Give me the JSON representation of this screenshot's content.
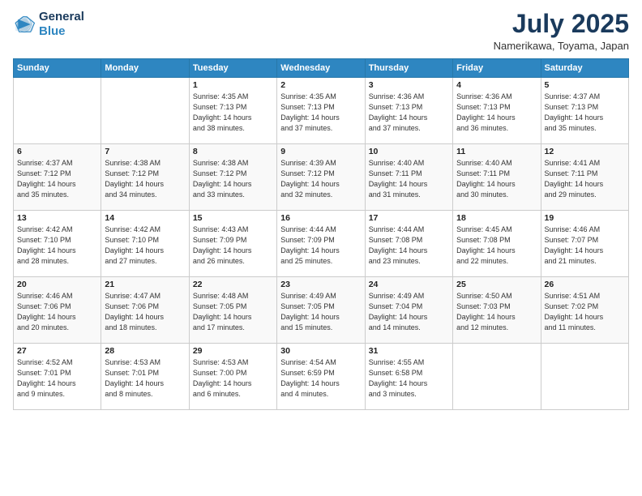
{
  "logo": {
    "line1": "General",
    "line2": "Blue"
  },
  "title": "July 2025",
  "subtitle": "Namerikawa, Toyama, Japan",
  "headers": [
    "Sunday",
    "Monday",
    "Tuesday",
    "Wednesday",
    "Thursday",
    "Friday",
    "Saturday"
  ],
  "weeks": [
    [
      {
        "day": "",
        "info": ""
      },
      {
        "day": "",
        "info": ""
      },
      {
        "day": "1",
        "info": "Sunrise: 4:35 AM\nSunset: 7:13 PM\nDaylight: 14 hours\nand 38 minutes."
      },
      {
        "day": "2",
        "info": "Sunrise: 4:35 AM\nSunset: 7:13 PM\nDaylight: 14 hours\nand 37 minutes."
      },
      {
        "day": "3",
        "info": "Sunrise: 4:36 AM\nSunset: 7:13 PM\nDaylight: 14 hours\nand 37 minutes."
      },
      {
        "day": "4",
        "info": "Sunrise: 4:36 AM\nSunset: 7:13 PM\nDaylight: 14 hours\nand 36 minutes."
      },
      {
        "day": "5",
        "info": "Sunrise: 4:37 AM\nSunset: 7:13 PM\nDaylight: 14 hours\nand 35 minutes."
      }
    ],
    [
      {
        "day": "6",
        "info": "Sunrise: 4:37 AM\nSunset: 7:12 PM\nDaylight: 14 hours\nand 35 minutes."
      },
      {
        "day": "7",
        "info": "Sunrise: 4:38 AM\nSunset: 7:12 PM\nDaylight: 14 hours\nand 34 minutes."
      },
      {
        "day": "8",
        "info": "Sunrise: 4:38 AM\nSunset: 7:12 PM\nDaylight: 14 hours\nand 33 minutes."
      },
      {
        "day": "9",
        "info": "Sunrise: 4:39 AM\nSunset: 7:12 PM\nDaylight: 14 hours\nand 32 minutes."
      },
      {
        "day": "10",
        "info": "Sunrise: 4:40 AM\nSunset: 7:11 PM\nDaylight: 14 hours\nand 31 minutes."
      },
      {
        "day": "11",
        "info": "Sunrise: 4:40 AM\nSunset: 7:11 PM\nDaylight: 14 hours\nand 30 minutes."
      },
      {
        "day": "12",
        "info": "Sunrise: 4:41 AM\nSunset: 7:11 PM\nDaylight: 14 hours\nand 29 minutes."
      }
    ],
    [
      {
        "day": "13",
        "info": "Sunrise: 4:42 AM\nSunset: 7:10 PM\nDaylight: 14 hours\nand 28 minutes."
      },
      {
        "day": "14",
        "info": "Sunrise: 4:42 AM\nSunset: 7:10 PM\nDaylight: 14 hours\nand 27 minutes."
      },
      {
        "day": "15",
        "info": "Sunrise: 4:43 AM\nSunset: 7:09 PM\nDaylight: 14 hours\nand 26 minutes."
      },
      {
        "day": "16",
        "info": "Sunrise: 4:44 AM\nSunset: 7:09 PM\nDaylight: 14 hours\nand 25 minutes."
      },
      {
        "day": "17",
        "info": "Sunrise: 4:44 AM\nSunset: 7:08 PM\nDaylight: 14 hours\nand 23 minutes."
      },
      {
        "day": "18",
        "info": "Sunrise: 4:45 AM\nSunset: 7:08 PM\nDaylight: 14 hours\nand 22 minutes."
      },
      {
        "day": "19",
        "info": "Sunrise: 4:46 AM\nSunset: 7:07 PM\nDaylight: 14 hours\nand 21 minutes."
      }
    ],
    [
      {
        "day": "20",
        "info": "Sunrise: 4:46 AM\nSunset: 7:06 PM\nDaylight: 14 hours\nand 20 minutes."
      },
      {
        "day": "21",
        "info": "Sunrise: 4:47 AM\nSunset: 7:06 PM\nDaylight: 14 hours\nand 18 minutes."
      },
      {
        "day": "22",
        "info": "Sunrise: 4:48 AM\nSunset: 7:05 PM\nDaylight: 14 hours\nand 17 minutes."
      },
      {
        "day": "23",
        "info": "Sunrise: 4:49 AM\nSunset: 7:05 PM\nDaylight: 14 hours\nand 15 minutes."
      },
      {
        "day": "24",
        "info": "Sunrise: 4:49 AM\nSunset: 7:04 PM\nDaylight: 14 hours\nand 14 minutes."
      },
      {
        "day": "25",
        "info": "Sunrise: 4:50 AM\nSunset: 7:03 PM\nDaylight: 14 hours\nand 12 minutes."
      },
      {
        "day": "26",
        "info": "Sunrise: 4:51 AM\nSunset: 7:02 PM\nDaylight: 14 hours\nand 11 minutes."
      }
    ],
    [
      {
        "day": "27",
        "info": "Sunrise: 4:52 AM\nSunset: 7:01 PM\nDaylight: 14 hours\nand 9 minutes."
      },
      {
        "day": "28",
        "info": "Sunrise: 4:53 AM\nSunset: 7:01 PM\nDaylight: 14 hours\nand 8 minutes."
      },
      {
        "day": "29",
        "info": "Sunrise: 4:53 AM\nSunset: 7:00 PM\nDaylight: 14 hours\nand 6 minutes."
      },
      {
        "day": "30",
        "info": "Sunrise: 4:54 AM\nSunset: 6:59 PM\nDaylight: 14 hours\nand 4 minutes."
      },
      {
        "day": "31",
        "info": "Sunrise: 4:55 AM\nSunset: 6:58 PM\nDaylight: 14 hours\nand 3 minutes."
      },
      {
        "day": "",
        "info": ""
      },
      {
        "day": "",
        "info": ""
      }
    ]
  ]
}
